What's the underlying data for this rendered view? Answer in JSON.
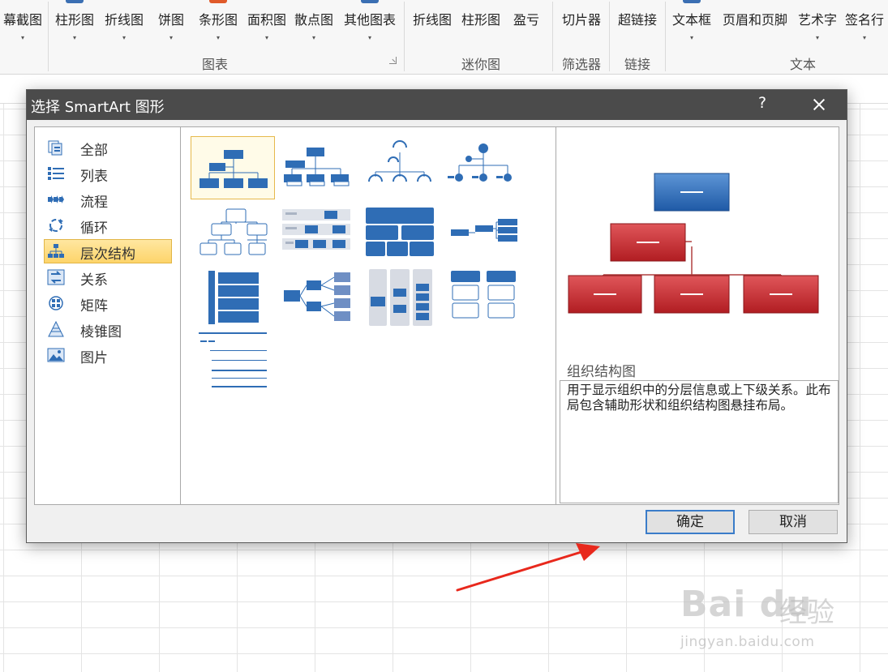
{
  "ribbon": {
    "buttons": [
      {
        "label": "幕截图",
        "arrow": "▾"
      },
      {
        "label": "柱形图",
        "arrow": "▾"
      },
      {
        "label": "折线图",
        "arrow": "▾"
      },
      {
        "label": "饼图",
        "arrow": "▾"
      },
      {
        "label": "条形图",
        "arrow": "▾"
      },
      {
        "label": "面积图",
        "arrow": "▾"
      },
      {
        "label": "散点图",
        "arrow": "▾"
      },
      {
        "label": "其他图表",
        "arrow": "▾"
      },
      {
        "label": "折线图"
      },
      {
        "label": "柱形图"
      },
      {
        "label": "盈亏"
      },
      {
        "label": "切片器"
      },
      {
        "label": "超链接"
      },
      {
        "label": "文本框",
        "arrow": "▾"
      },
      {
        "label": "页眉和页脚"
      },
      {
        "label": "艺术字",
        "arrow": "▾"
      },
      {
        "label": "签名行",
        "arrow": "▾"
      }
    ],
    "groups": [
      {
        "label": "图表"
      },
      {
        "label": "迷你图"
      },
      {
        "label": "筛选器"
      },
      {
        "label": "链接"
      },
      {
        "label": "文本"
      }
    ],
    "launcher_icon": "dialog-launcher-icon"
  },
  "dialog": {
    "title": "选择 SmartArt 图形",
    "help_label": "?",
    "close_icon": "close-icon",
    "categories": [
      {
        "label": "全部",
        "icon": "all-icon"
      },
      {
        "label": "列表",
        "icon": "list-icon"
      },
      {
        "label": "流程",
        "icon": "process-icon"
      },
      {
        "label": "循环",
        "icon": "cycle-icon"
      },
      {
        "label": "层次结构",
        "icon": "hierarchy-icon",
        "selected": true
      },
      {
        "label": "关系",
        "icon": "relationship-icon"
      },
      {
        "label": "矩阵",
        "icon": "matrix-icon"
      },
      {
        "label": "棱锥图",
        "icon": "pyramid-icon"
      },
      {
        "label": "图片",
        "icon": "picture-icon"
      }
    ],
    "layouts": [
      {
        "icon": "organization-chart-thumb",
        "selected": true
      },
      {
        "icon": "name-title-org-chart-thumb"
      },
      {
        "icon": "half-circle-org-chart-thumb"
      },
      {
        "icon": "circle-picture-hierarchy-thumb"
      },
      {
        "icon": "hierarchy-thumb"
      },
      {
        "icon": "labeled-hierarchy-thumb"
      },
      {
        "icon": "table-hierarchy-thumb"
      },
      {
        "icon": "horizontal-hierarchy-thumb"
      },
      {
        "icon": "horizontal-labeled-hierarchy-thumb"
      },
      {
        "icon": "horizontal-multi-level-hierarchy-thumb"
      },
      {
        "icon": "horizontal-org-chart-thumb"
      },
      {
        "icon": "hierarchy-list-thumb"
      },
      {
        "icon": "lined-list-thumb"
      }
    ],
    "preview": {
      "icon": "organization-chart-preview",
      "name": "组织结构图",
      "description": "用于显示组织中的分层信息或上下级关系。此布局包含辅助形状和组织结构图悬挂布局。"
    },
    "ok_label": "确定",
    "cancel_label": "取消"
  },
  "annotations": {
    "arrow_color": "#e8281c",
    "watermark_logo": "Bai du",
    "watermark_sub": "经验",
    "watermark_url": "jingyan.baidu.com"
  },
  "colors": {
    "accent_blue": "#2f6db5",
    "accent_red": "#c0262a",
    "selection_yellow": "#fdd46a",
    "title_bar": "#4b4b4b"
  }
}
